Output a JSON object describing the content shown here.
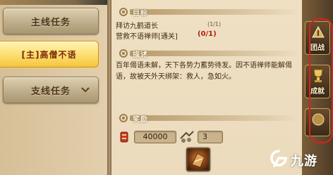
{
  "left_panel": {
    "main_quest_tab": "主线任务",
    "active_quest": "[主]高僧不语",
    "side_quest_tab": "支线任务"
  },
  "detail": {
    "goal_header": "目标",
    "goal_line_1": "拜访九鹤道长",
    "goal_line_1_count": "(1/1)",
    "goal_line_2": "营救不语禅师[通关]",
    "goal_line_2_count": "(0/1)",
    "description_header": "描述",
    "description": "百年偈语未解，天下各势力蓄势待发。因不语禅师能解偈语，故被天外天绑架：救人，急如火。",
    "reward_header": "奖励",
    "reward_gold": "40000",
    "reward_exp": "3"
  },
  "side_buttons": [
    {
      "label": "团战",
      "icon": "team-battle-icon"
    },
    {
      "label": "成就",
      "icon": "trophy-icon"
    },
    {
      "label": "",
      "icon": "extra-menu-icon"
    }
  ],
  "watermark": {
    "text": "九游"
  },
  "colors": {
    "active_quest_bg": "#f4c63e",
    "active_quest_text": "#7a2a0c",
    "count_red": "#b21d10",
    "annotation_circle": "#d8231c"
  }
}
